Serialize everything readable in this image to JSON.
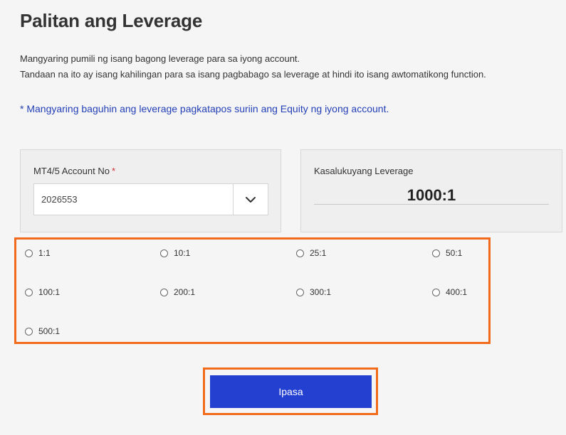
{
  "page": {
    "title": "Palitan ang Leverage",
    "description_line1": "Mangyaring pumili ng isang bagong leverage para sa iyong account.",
    "description_line2": "Tandaan na ito ay isang kahilingan para sa isang pagbabago sa leverage at hindi ito isang awtomatikong function.",
    "note": "* Mangyaring baguhin ang leverage pagkatapos suriin ang Equity ng iyong account."
  },
  "account": {
    "label": "MT4/5 Account No",
    "required_mark": "*",
    "selected_value": "2026553",
    "dropdown_icon": "chevron-down-icon"
  },
  "current_leverage": {
    "label": "Kasalukuyang Leverage",
    "value": "1000:1"
  },
  "leverage_options": [
    "1:1",
    "10:1",
    "25:1",
    "50:1",
    "100:1",
    "200:1",
    "300:1",
    "400:1",
    "500:1"
  ],
  "submit": {
    "label": "Ipasa"
  },
  "colors": {
    "accent_blue": "#2340d1",
    "note_blue": "#2440b6",
    "highlight_orange": "#f26a1b",
    "required_red": "#d32f2f"
  }
}
